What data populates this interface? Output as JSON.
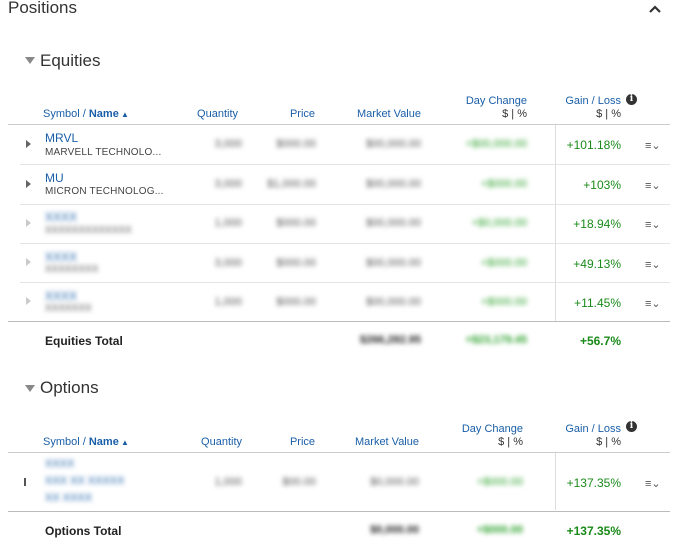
{
  "header": {
    "title": "Positions"
  },
  "columns": {
    "symbol": "Symbol / ",
    "name": "Name",
    "quantity": "Quantity",
    "price": "Price",
    "market_value": "Market Value",
    "day_change": "Day Change",
    "day_change_sub": "$ | %",
    "gain_loss": "Gain / Loss",
    "gain_loss_sub": "$ | %"
  },
  "equities": {
    "title": "Equities",
    "rows": [
      {
        "symbol": "MRVL",
        "name": "MARVELL TECHNOLO...",
        "gain_pct": "+101.18%"
      },
      {
        "symbol": "MU",
        "name": "MICRON TECHNOLOG...",
        "gain_pct": "+103%"
      },
      {
        "gain_pct": "+18.94%"
      },
      {
        "gain_pct": "+49.13%"
      },
      {
        "gain_pct": "+11.45%"
      }
    ],
    "total": {
      "label": "Equities Total",
      "market_value": "$266,282.95",
      "day_change": "+$23,179.45",
      "gain_pct": "+56.7%"
    }
  },
  "options": {
    "title": "Options",
    "rows": [
      {
        "gain_pct": "+137.35%"
      }
    ],
    "total": {
      "label": "Options Total",
      "gain_pct": "+137.35%"
    }
  },
  "icons": {
    "collapse": "chevron-up-icon",
    "info": "info-icon",
    "menu": "row-menu-icon",
    "expand": "expand-row-icon"
  }
}
